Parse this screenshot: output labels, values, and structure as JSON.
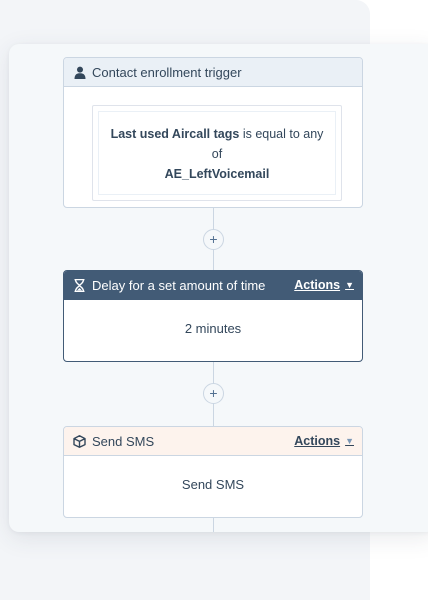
{
  "trigger": {
    "header": "Contact enrollment trigger",
    "filter_property": "Last used Aircall tags",
    "filter_operator": "is equal to any of",
    "filter_value": "AE_LeftVoicemail"
  },
  "add_button_symbol": "+",
  "delay": {
    "header": "Delay for a set amount of time",
    "actions_label": "Actions",
    "body": "2 minutes"
  },
  "sms": {
    "header": "Send SMS",
    "actions_label": "Actions",
    "body": "Send SMS"
  },
  "icons": {
    "trigger": "person-icon",
    "delay": "hourglass-icon",
    "sms": "cube-icon",
    "actions_caret": "caret-down-icon"
  },
  "colors": {
    "delay_header_bg": "#425b76",
    "sms_header_bg": "#fdf3ed",
    "trigger_header_bg": "#eaf0f6",
    "border": "#cbd6e2"
  }
}
